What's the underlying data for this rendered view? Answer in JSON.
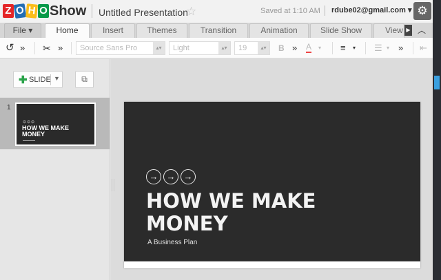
{
  "header": {
    "logo_letters": [
      "Z",
      "O",
      "H",
      "O"
    ],
    "logo_colors": [
      "#e42527",
      "#226db4",
      "#fbbd19",
      "#089949"
    ],
    "app_name": "Show",
    "doc_title": "Untitled Presentation",
    "saved_status": "Saved at 1:10 AM",
    "user_email": "rdube02@gmail.com ▾",
    "settings_icon": "gear-icon",
    "star_icon": "star-icon"
  },
  "tabs": [
    {
      "label": "File ▾"
    },
    {
      "label": "Home"
    },
    {
      "label": "Insert"
    },
    {
      "label": "Themes"
    },
    {
      "label": "Transition"
    },
    {
      "label": "Animation"
    },
    {
      "label": "Slide Show"
    },
    {
      "label": "View"
    }
  ],
  "toolbar": {
    "font_family": "Source Sans Pro",
    "font_weight": "Light",
    "font_size": "19",
    "bold": "B",
    "more": "»",
    "font_color": "A"
  },
  "left_panel": {
    "slide_button_label": "SLIDE",
    "thumbnail_number": "1",
    "thumbnail_title": "HOW WE MAKE MONEY",
    "thumbnail_arrows": "⊝⊝⊝"
  },
  "slide": {
    "arrow": "→",
    "title": "HOW WE MAKE MONEY",
    "subtitle": "A Business Plan"
  },
  "colors": {
    "accent_green": "#2aa34a",
    "slide_background": "#2b2b2b",
    "scrollbar_thumb": "#3ba0e0"
  }
}
